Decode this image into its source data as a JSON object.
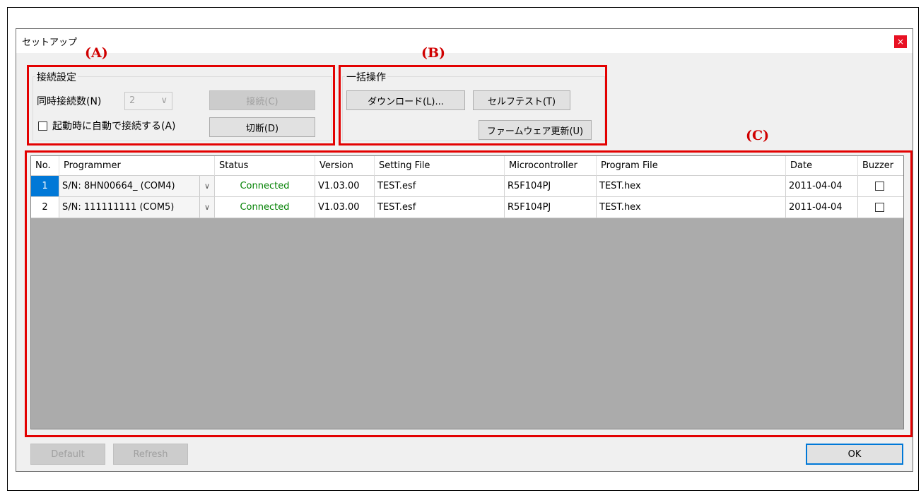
{
  "dialog": {
    "title": "セットアップ",
    "close": "×"
  },
  "callouts": {
    "a": "(A)",
    "b": "(B)",
    "c": "(C)"
  },
  "connection_group": {
    "label": "接続設定",
    "simultaneous_label": "同時接続数(N)",
    "simultaneous_value": "2",
    "connect_button": "接続(C)",
    "auto_connect_label": "起動時に自動で接続する(A)",
    "disconnect_button": "切断(D)"
  },
  "batch_group": {
    "label": "一括操作",
    "download_button": "ダウンロード(L)...",
    "selftest_button": "セルフテスト(T)",
    "firmware_button": "ファームウェア更新(U)"
  },
  "table": {
    "headers": [
      "No.",
      "Programmer",
      "Status",
      "Version",
      "Setting File",
      "Microcontroller",
      "Program File",
      "Date",
      "Buzzer"
    ],
    "rows": [
      {
        "no": "1",
        "programmer": "S/N: 8HN00664_ (COM4)",
        "status": "Connected",
        "version": "V1.03.00",
        "setting_file": "TEST.esf",
        "mcu": "R5F104PJ",
        "program_file": "TEST.hex",
        "date": "2011-04-04"
      },
      {
        "no": "2",
        "programmer": "S/N: 111111111 (COM5)",
        "status": "Connected",
        "version": "V1.03.00",
        "setting_file": "TEST.esf",
        "mcu": "R5F104PJ",
        "program_file": "TEST.hex",
        "date": "2011-04-04"
      }
    ]
  },
  "footer": {
    "default_button": "Default",
    "refresh_button": "Refresh",
    "ok_button": "OK"
  },
  "colors": {
    "callout": "#d00000",
    "highlight_box": "#e30000",
    "status_connected": "#008000",
    "selected_row_number": "#0078d7"
  }
}
